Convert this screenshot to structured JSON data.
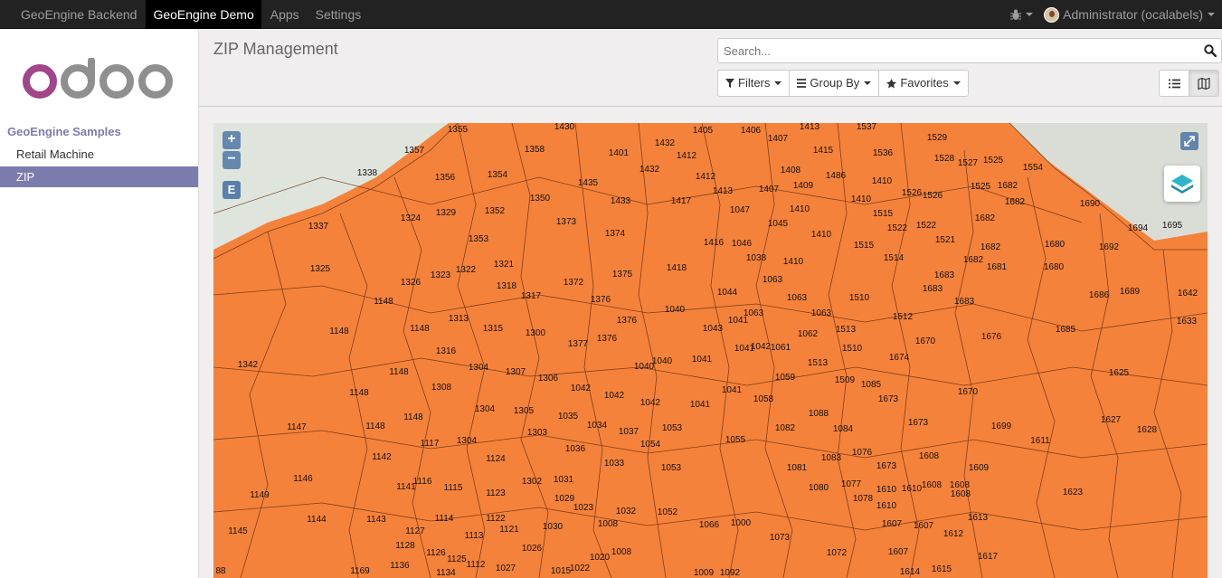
{
  "topbar": {
    "menu": [
      "GeoEngine Backend",
      "GeoEngine Demo",
      "Apps",
      "Settings"
    ],
    "active_index": 1,
    "user_name": "Administrator (ocalabels)"
  },
  "sidebar": {
    "section": "GeoEngine Samples",
    "items": [
      "Retail Machine",
      "ZIP"
    ],
    "active_index": 1
  },
  "control_panel": {
    "title": "ZIP Management",
    "search_placeholder": "Search...",
    "filters_label": "Filters",
    "group_by_label": "Group By",
    "favorites_label": "Favorites"
  },
  "map": {
    "fill_color": "#f5823a",
    "edit_label": "E",
    "zip_labels": [
      [
        "1355",
        270,
        4
      ],
      [
        "1430",
        388,
        0
      ],
      [
        "1405",
        541,
        5
      ],
      [
        "1406",
        594,
        5
      ],
      [
        "1413",
        659,
        0
      ],
      [
        "1537",
        722,
        0
      ],
      [
        "1357",
        222,
        27
      ],
      [
        "1358",
        355,
        26
      ],
      [
        "1401",
        448,
        30
      ],
      [
        "1432",
        499,
        19
      ],
      [
        "1412",
        523,
        33
      ],
      [
        "1407",
        624,
        14
      ],
      [
        "1415",
        674,
        27
      ],
      [
        "1536",
        740,
        30
      ],
      [
        "1529",
        800,
        13
      ],
      [
        "1338",
        170,
        52
      ],
      [
        "1356",
        256,
        57
      ],
      [
        "1354",
        314,
        54
      ],
      [
        "1432",
        482,
        48
      ],
      [
        "1412",
        544,
        56
      ],
      [
        "1408",
        638,
        49
      ],
      [
        "1486",
        688,
        55
      ],
      [
        "1410",
        739,
        61
      ],
      [
        "1528",
        808,
        36
      ],
      [
        "1527",
        834,
        41
      ],
      [
        "1525",
        862,
        38
      ],
      [
        "1554",
        906,
        46
      ],
      [
        "1435",
        414,
        63
      ],
      [
        "1413",
        563,
        72
      ],
      [
        "1407",
        614,
        70
      ],
      [
        "1409",
        652,
        66
      ],
      [
        "1526",
        772,
        74
      ],
      [
        "1526",
        795,
        77
      ],
      [
        "1525",
        848,
        67
      ],
      [
        "1682",
        878,
        66
      ],
      [
        "1350",
        361,
        80
      ],
      [
        "1433",
        450,
        83
      ],
      [
        "1417",
        517,
        83
      ],
      [
        "1047",
        582,
        93
      ],
      [
        "1410",
        648,
        92
      ],
      [
        "1410",
        716,
        81
      ],
      [
        "1682",
        886,
        84
      ],
      [
        "1690",
        969,
        86
      ],
      [
        "1324",
        218,
        102
      ],
      [
        "1329",
        257,
        96
      ],
      [
        "1352",
        311,
        94
      ],
      [
        "1373",
        390,
        106
      ],
      [
        "1045",
        624,
        108
      ],
      [
        "1515",
        740,
        97
      ],
      [
        "1522",
        756,
        113
      ],
      [
        "1522",
        788,
        110
      ],
      [
        "1682",
        853,
        102
      ],
      [
        "1694",
        1022,
        113
      ],
      [
        "1695",
        1060,
        110
      ],
      [
        "1337",
        116,
        111
      ],
      [
        "1353",
        293,
        125
      ],
      [
        "1374",
        444,
        119
      ],
      [
        "1416",
        553,
        129
      ],
      [
        "1046",
        584,
        130
      ],
      [
        "1410",
        672,
        120
      ],
      [
        "1515",
        719,
        132
      ],
      [
        "1521",
        809,
        126
      ],
      [
        "1682",
        859,
        134
      ],
      [
        "1680",
        930,
        131
      ],
      [
        "1692",
        990,
        134
      ],
      [
        "1038",
        600,
        146
      ],
      [
        "1514",
        752,
        146
      ],
      [
        "1682",
        840,
        148
      ],
      [
        "1681",
        866,
        156
      ],
      [
        "1680",
        929,
        156
      ],
      [
        "1325",
        118,
        158
      ],
      [
        "1321",
        321,
        153
      ],
      [
        "1375",
        452,
        164
      ],
      [
        "1418",
        512,
        157
      ],
      [
        "1410",
        641,
        150
      ],
      [
        "1683",
        808,
        165
      ],
      [
        "1326",
        218,
        173
      ],
      [
        "1323",
        251,
        165
      ],
      [
        "1322",
        279,
        159
      ],
      [
        "1318",
        324,
        177
      ],
      [
        "1372",
        398,
        173
      ],
      [
        "1063",
        618,
        170
      ],
      [
        "1683",
        795,
        180
      ],
      [
        "1686",
        979,
        187
      ],
      [
        "1689",
        1013,
        183
      ],
      [
        "1642",
        1077,
        185
      ],
      [
        "1148",
        188,
        194
      ],
      [
        "1317",
        351,
        188
      ],
      [
        "1376",
        428,
        192
      ],
      [
        "1044",
        568,
        184
      ],
      [
        "1063",
        645,
        190
      ],
      [
        "1510",
        714,
        190
      ],
      [
        "1683",
        830,
        194
      ],
      [
        "1040",
        510,
        203
      ],
      [
        "1063",
        597,
        207
      ],
      [
        "1063",
        672,
        207
      ],
      [
        "1512",
        762,
        211
      ],
      [
        "1633",
        1076,
        216
      ],
      [
        "1313",
        271,
        213
      ],
      [
        "1376",
        457,
        215
      ],
      [
        "1041",
        580,
        215
      ],
      [
        "1043",
        552,
        224
      ],
      [
        "1513",
        699,
        225
      ],
      [
        "1062",
        657,
        230
      ],
      [
        "1148",
        139,
        227
      ],
      [
        "1148",
        228,
        224
      ],
      [
        "1315",
        309,
        224
      ],
      [
        "1300",
        356,
        229
      ],
      [
        "1376",
        435,
        235
      ],
      [
        "1377",
        403,
        241
      ],
      [
        "1670",
        787,
        238
      ],
      [
        "1676",
        860,
        233
      ],
      [
        "1685",
        942,
        225
      ],
      [
        "1316",
        257,
        249
      ],
      [
        "1041",
        587,
        246
      ],
      [
        "1042",
        605,
        244
      ],
      [
        "1061",
        627,
        245
      ],
      [
        "1510",
        706,
        246
      ],
      [
        "1674",
        758,
        256
      ],
      [
        "1342",
        38,
        264
      ],
      [
        "1304",
        293,
        267
      ],
      [
        "1040",
        476,
        266
      ],
      [
        "1040",
        496,
        260
      ],
      [
        "1041",
        540,
        258
      ],
      [
        "1513",
        668,
        262
      ],
      [
        "1148",
        205,
        272
      ],
      [
        "1307",
        334,
        272
      ],
      [
        "1306",
        370,
        279
      ],
      [
        "1059",
        632,
        278
      ],
      [
        "1509",
        698,
        281
      ],
      [
        "1085",
        727,
        286
      ],
      [
        "1625",
        1001,
        273
      ],
      [
        "1308",
        252,
        289
      ],
      [
        "1042",
        406,
        290
      ],
      [
        "1042",
        443,
        298
      ],
      [
        "1041",
        573,
        292
      ],
      [
        "1673",
        746,
        302
      ],
      [
        "1670",
        834,
        294
      ],
      [
        "1148",
        161,
        295
      ],
      [
        "1042",
        483,
        306
      ],
      [
        "1041",
        538,
        308
      ],
      [
        "1058",
        608,
        302
      ],
      [
        "1304",
        300,
        313
      ],
      [
        "1305",
        343,
        315
      ],
      [
        "1035",
        392,
        321
      ],
      [
        "1088",
        669,
        318
      ],
      [
        "1673",
        779,
        328
      ],
      [
        "1627",
        992,
        325
      ],
      [
        "1148",
        221,
        322
      ],
      [
        "1034",
        424,
        331
      ],
      [
        "1037",
        459,
        338
      ],
      [
        "1053",
        507,
        334
      ],
      [
        "1082",
        632,
        334
      ],
      [
        "1084",
        696,
        335
      ],
      [
        "1699",
        871,
        332
      ],
      [
        "1628",
        1032,
        336
      ],
      [
        "1147",
        92,
        333
      ],
      [
        "1148",
        179,
        332
      ],
      [
        "1303",
        358,
        339
      ],
      [
        "1055",
        577,
        347
      ],
      [
        "1611",
        914,
        348
      ],
      [
        "1117",
        239,
        351
      ],
      [
        "1304",
        280,
        348
      ],
      [
        "1036",
        400,
        357
      ],
      [
        "1054",
        483,
        352
      ],
      [
        "1076",
        717,
        361
      ],
      [
        "1608",
        791,
        365
      ],
      [
        "1609",
        846,
        378
      ],
      [
        "1142",
        186,
        366
      ],
      [
        "1124",
        312,
        368
      ],
      [
        "1033",
        443,
        373
      ],
      [
        "1053",
        506,
        378
      ],
      [
        "1081",
        645,
        378
      ],
      [
        "1083",
        683,
        367
      ],
      [
        "1673",
        744,
        376
      ],
      [
        "1146",
        99,
        390
      ],
      [
        "1116",
        231,
        393
      ],
      [
        "1302",
        352,
        393
      ],
      [
        "1031",
        387,
        391
      ],
      [
        "1077",
        705,
        396
      ],
      [
        "1080",
        669,
        400
      ],
      [
        "1610",
        744,
        402
      ],
      [
        "1610",
        772,
        401
      ],
      [
        "1608",
        794,
        397
      ],
      [
        "1608",
        825,
        397
      ],
      [
        "1623",
        950,
        405
      ],
      [
        "1141",
        213,
        399
      ],
      [
        "1115",
        265,
        400
      ],
      [
        "1123",
        312,
        406
      ],
      [
        "1029",
        388,
        412
      ],
      [
        "1078",
        718,
        412
      ],
      [
        "1608",
        826,
        407
      ],
      [
        "1149",
        51,
        408
      ],
      [
        "1023",
        409,
        422
      ],
      [
        "1032",
        456,
        426
      ],
      [
        "1052",
        502,
        427
      ],
      [
        "1610",
        744,
        420
      ],
      [
        "1144",
        114,
        435
      ],
      [
        "1143",
        180,
        435
      ],
      [
        "1114",
        255,
        434
      ],
      [
        "1122",
        312,
        434
      ],
      [
        "1008",
        436,
        440
      ],
      [
        "1066",
        548,
        441
      ],
      [
        "1000",
        583,
        439
      ],
      [
        "1607",
        750,
        440
      ],
      [
        "1607",
        785,
        442
      ],
      [
        "1613",
        845,
        433
      ],
      [
        "1145",
        27,
        448
      ],
      [
        "1127",
        223,
        448
      ],
      [
        "1113",
        288,
        453
      ],
      [
        "1121",
        327,
        446
      ],
      [
        "1030",
        375,
        443
      ],
      [
        "1073",
        626,
        455
      ],
      [
        "1612",
        818,
        451
      ],
      [
        "1128",
        212,
        464
      ],
      [
        "1026",
        352,
        467
      ],
      [
        "1126",
        246,
        472
      ],
      [
        "1125",
        269,
        479
      ],
      [
        "1112",
        290,
        485
      ],
      [
        "1027",
        323,
        489
      ],
      [
        "1020",
        427,
        477
      ],
      [
        "1008",
        451,
        471
      ],
      [
        "1072",
        689,
        472
      ],
      [
        "1607",
        757,
        471
      ],
      [
        "1617",
        856,
        476
      ],
      [
        "1169",
        162,
        492
      ],
      [
        "1136",
        206,
        486
      ],
      [
        "1015",
        384,
        492
      ],
      [
        "1022",
        405,
        489
      ],
      [
        "1614",
        770,
        493
      ],
      [
        "1615",
        805,
        490
      ],
      [
        "88",
        4,
        492
      ],
      [
        "1134",
        257,
        501
      ],
      [
        "1009",
        542,
        500
      ],
      [
        "1092",
        571,
        496
      ]
    ]
  }
}
